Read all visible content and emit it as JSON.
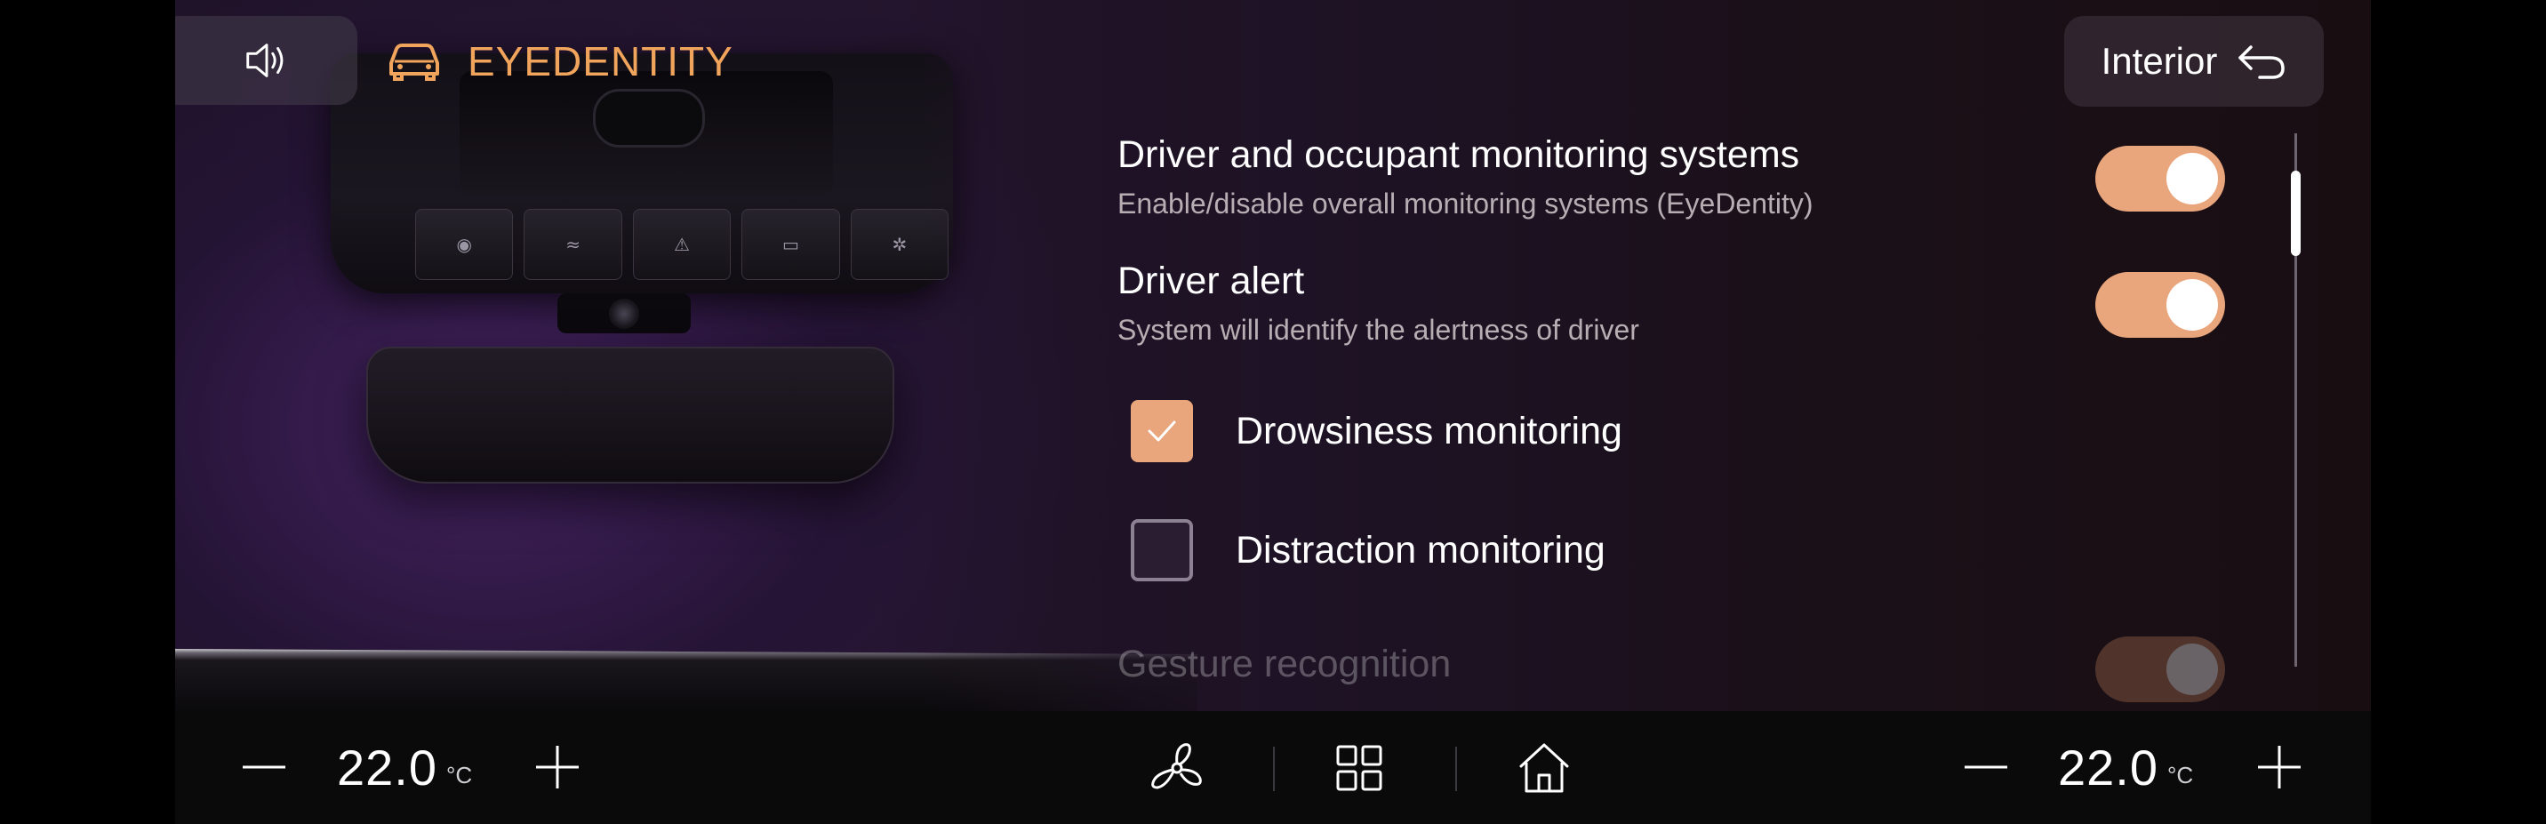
{
  "header": {
    "sound_icon": "speaker-volume-icon",
    "app_icon": "car-icon",
    "app_title": "EYEDENTITY",
    "back_button": {
      "label": "Interior",
      "icon": "back-arrow-icon"
    }
  },
  "settings": {
    "monitoring": {
      "title": "Driver and occupant monitoring systems",
      "description": "Enable/disable overall monitoring systems (EyeDentity)",
      "enabled": true
    },
    "driver_alert": {
      "title": "Driver alert",
      "description": "System will identify the alertness of driver",
      "enabled": true
    },
    "drowsiness": {
      "label": "Drowsiness monitoring",
      "checked": true
    },
    "distraction": {
      "label": "Distraction monitoring",
      "checked": false
    },
    "gesture": {
      "title": "Gesture recognition",
      "enabled": true
    }
  },
  "climate": {
    "left_temp": "22.0",
    "right_temp": "22.0",
    "unit": "°C",
    "icons": [
      "minus-icon",
      "plus-icon",
      "fan-icon",
      "apps-grid-icon",
      "home-icon"
    ]
  },
  "colors": {
    "accent": "#f0a45c",
    "toggle_on": "#e9a57c",
    "background": "#1e1328"
  }
}
